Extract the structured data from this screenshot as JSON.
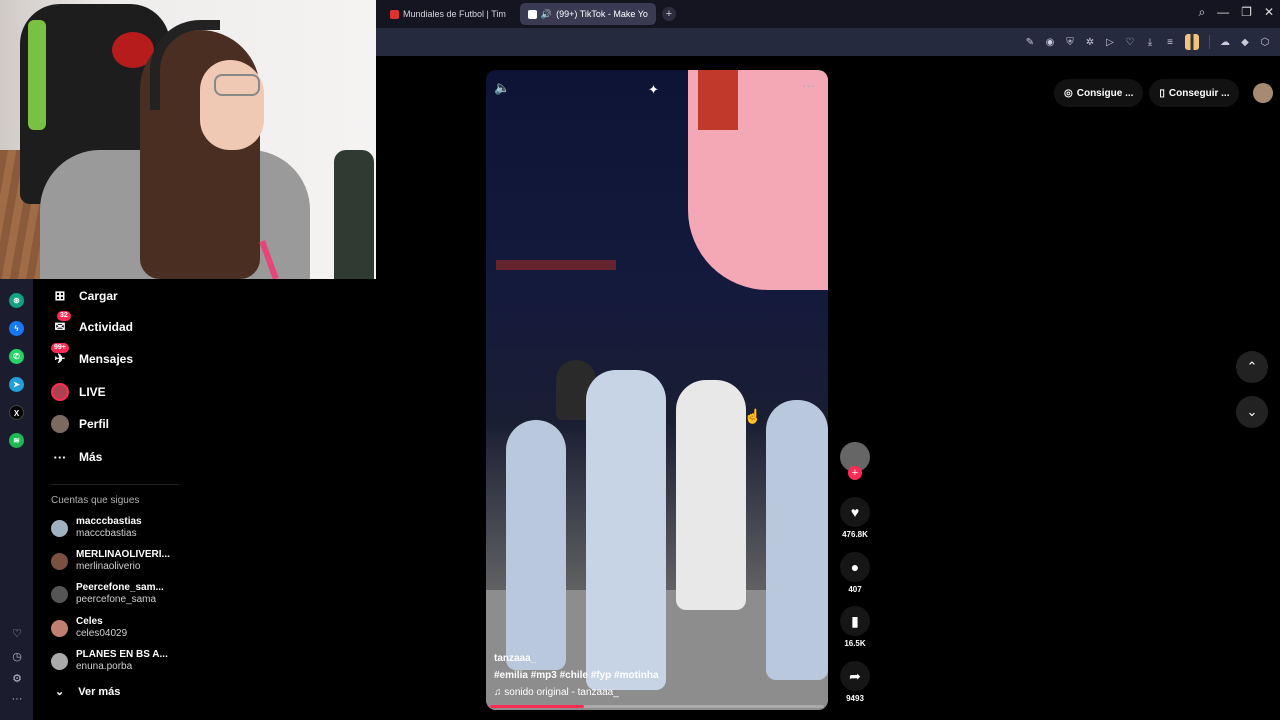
{
  "browser": {
    "tabs": [
      {
        "label": "Mundiales de Futbol | Tim",
        "active": false,
        "favicon_color": "#e03131"
      },
      {
        "label": "(99+) TikTok - Make Yo",
        "active": true,
        "favicon_color": "#ffffff"
      }
    ],
    "new_tab": "+",
    "controls": {
      "search": "⌕",
      "minimize": "—",
      "restore": "❐",
      "close": "✕"
    }
  },
  "sidebar": {
    "items": [
      {
        "label": "Cargar",
        "icon": "plus-box-icon",
        "glyph": "⊞"
      },
      {
        "label": "Actividad",
        "icon": "inbox-icon",
        "glyph": "✉",
        "badge": "32"
      },
      {
        "label": "Mensajes",
        "icon": "message-icon",
        "glyph": "✈",
        "badge": "99+"
      },
      {
        "label": "LIVE",
        "icon": "live-icon"
      },
      {
        "label": "Perfil",
        "icon": "profile-avatar"
      },
      {
        "label": "Más",
        "icon": "more-icon",
        "glyph": "···"
      }
    ],
    "following_label": "Cuentas que sigues",
    "accounts": [
      {
        "name": "macccbastias",
        "handle": "macccbastias"
      },
      {
        "name": "MERLINAOLIVERI...",
        "handle": "merlinaoliverio"
      },
      {
        "name": "Peercefone_sam...",
        "handle": "peercefone_sama"
      },
      {
        "name": "Celes",
        "handle": "celes04029"
      },
      {
        "name": "PLANES EN BS A...",
        "handle": "enuna.porba"
      }
    ],
    "see_more": "Ver más"
  },
  "video": {
    "username": "tanzaaa_",
    "hashtags": "#emilia  #mp3  #chile  #fyp  #motinha",
    "sound": "♫  sonido original - tanzaaa_",
    "progress": 0.28,
    "more": "···"
  },
  "actions": {
    "likes": "476.8K",
    "comments": "407",
    "saves": "16.5K",
    "shares": "9493"
  },
  "top_buttons": {
    "get_coins": "Consigue ...",
    "get_app": "Conseguir ..."
  },
  "colors": {
    "accent": "#fe2c55",
    "toolbar": "#262a3f"
  }
}
